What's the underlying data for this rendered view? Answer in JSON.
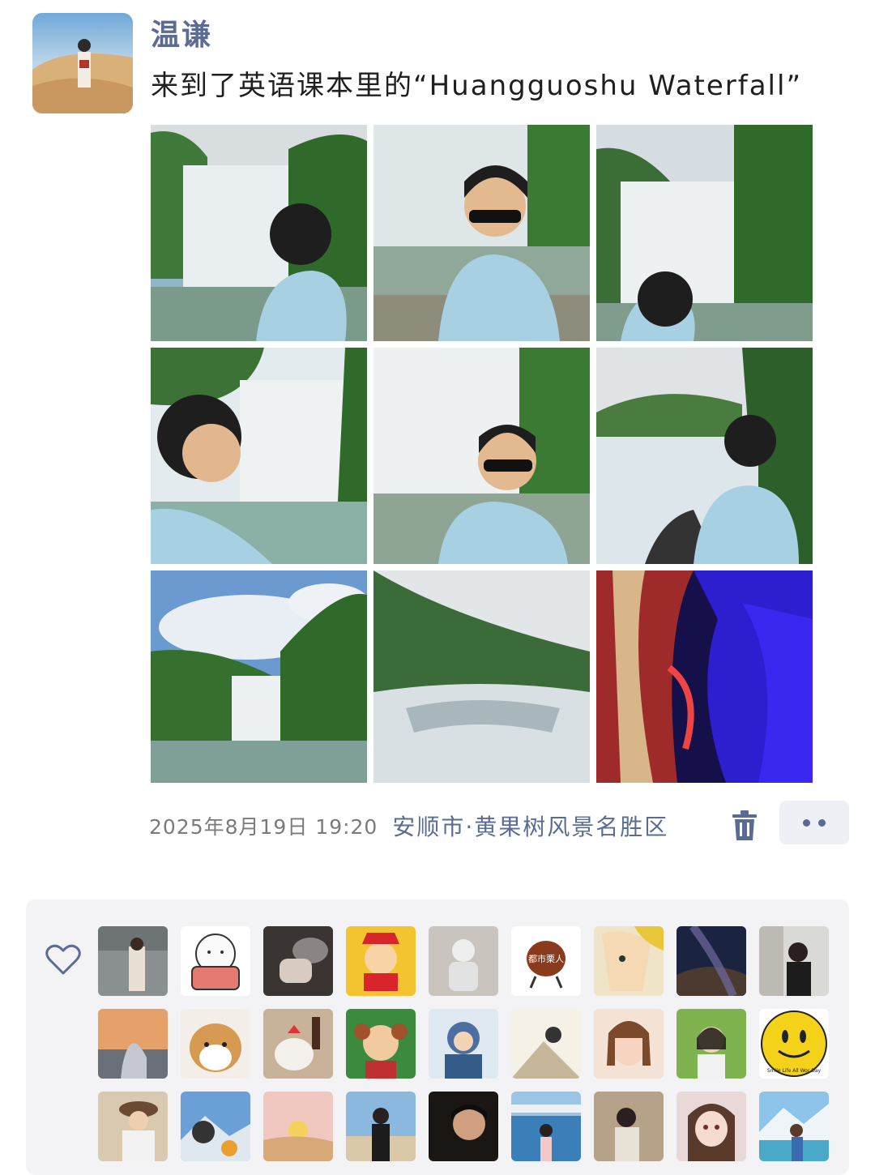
{
  "post": {
    "username": "温谦",
    "text": "来到了英语课本里的“Huangguoshu Waterfall”",
    "timestamp": "2025年8月19日 19:20",
    "location": "安顺市·黄果树风景名胜区",
    "photos": [
      {
        "alt": "waterfall-back-view"
      },
      {
        "alt": "waterfall-portrait-sunglasses"
      },
      {
        "alt": "waterfall-looking-right"
      },
      {
        "alt": "waterfall-side-profile"
      },
      {
        "alt": "waterfall-portrait-front"
      },
      {
        "alt": "waterfall-railing-view"
      },
      {
        "alt": "waterfall-landscape"
      },
      {
        "alt": "waterfall-cascade"
      },
      {
        "alt": "colorful-cave"
      }
    ]
  },
  "likers": {
    "avatar_text_1": "都市栗人",
    "avatar_text_2": "Smile Life All Wor Day"
  },
  "colors": {
    "accent": "#5a6b95",
    "meta_gray": "#7b7b7b",
    "panel_bg": "#f3f3f5"
  }
}
